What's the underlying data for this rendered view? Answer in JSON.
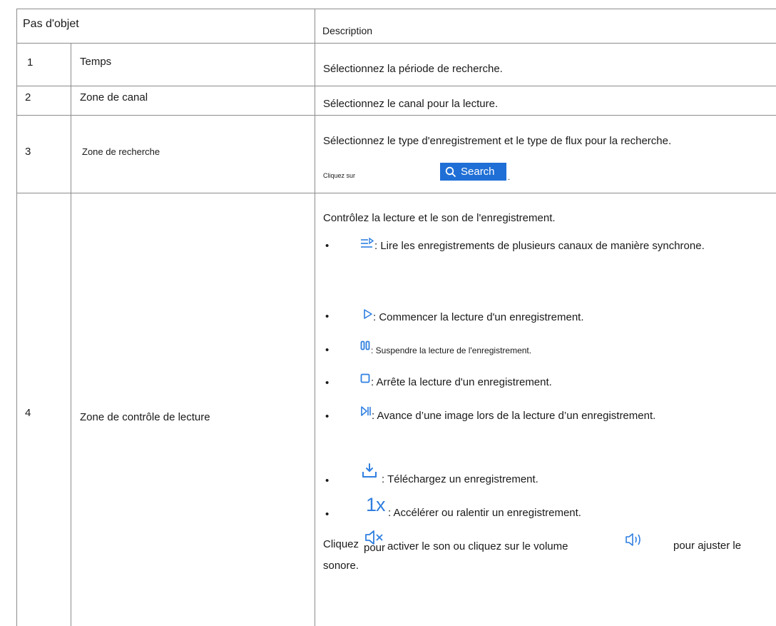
{
  "header": {
    "col1": "Pas d'objet",
    "col3": "Description"
  },
  "rows": [
    {
      "num": "1",
      "name": "Temps",
      "desc": "Sélectionnez la période de recherche."
    },
    {
      "num": "2",
      "name": "Zone de canal",
      "desc": "Sélectionnez le canal pour la lecture."
    },
    {
      "num": "3",
      "name": "Zone de recherche",
      "desc": "Sélectionnez le type d'enregistrement et le type de flux pour la recherche.",
      "click_label": "Cliquez sur",
      "search_label": "Search",
      "click_suffix": "."
    },
    {
      "num": "4",
      "name": "Zone de contrôle de lecture",
      "intro": "Contrôlez la lecture et le son de l'enregistrement.",
      "items": [
        {
          "icon": "sync-play-icon",
          "text": ": Lire les enregistrements de plusieurs canaux de manière synchrone."
        },
        {
          "icon": "play-icon",
          "text": ": Commencer la lecture d'un enregistrement."
        },
        {
          "icon": "pause-icon",
          "text": ": Suspendre la lecture de l'enregistrement."
        },
        {
          "icon": "stop-icon",
          "text": ": Arrête la lecture d'un enregistrement."
        },
        {
          "icon": "frame-step-icon",
          "text": ": Avance d’une image lors de la lecture d’un enregistrement."
        },
        {
          "icon": "download-icon",
          "text": ": Téléchargez un enregistrement."
        },
        {
          "icon": "speed-icon",
          "speed_label": "1x",
          "text": ": Accélérer ou ralentir un enregistrement."
        }
      ],
      "sound_cliquez": "Cliquez",
      "sound_pour": "pour",
      "sound_middle": "activer le son ou cliquez sur le volume",
      "sound_end": "pour ajuster le",
      "sound_last": "sonore."
    }
  ],
  "colors": {
    "accent": "#1f6fd6",
    "icon_blue": "#2f7fe0",
    "grid": "#8c8c8c"
  }
}
